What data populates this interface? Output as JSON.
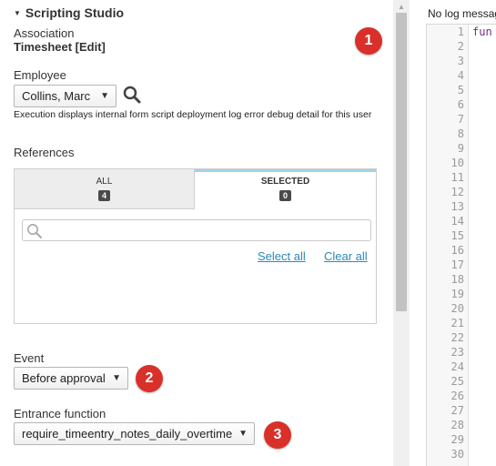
{
  "studio": {
    "title": "Scripting Studio",
    "association_label": "Association",
    "association_value": "Timesheet [Edit]",
    "employee_label": "Employee",
    "employee_value": "Collins, Marc",
    "execution_note": "Execution displays internal form script deployment log error debug detail for this user",
    "references_label": "References",
    "tabs": [
      {
        "label": "ALL",
        "count": "4"
      },
      {
        "label": "SELECTED",
        "count": "0"
      }
    ],
    "select_all": "Select all",
    "clear_all": "Clear all",
    "event_label": "Event",
    "event_value": "Before approval",
    "entrance_label": "Entrance function",
    "entrance_value": "require_timeentry_notes_daily_overtime"
  },
  "badges": [
    "1",
    "2",
    "3"
  ],
  "log": {
    "message": "No log messages"
  },
  "editor": {
    "code_line1": "fun",
    "line_numbers": [
      "1",
      "2",
      "3",
      "4",
      "5",
      "6",
      "7",
      "8",
      "9",
      "10",
      "11",
      "12",
      "13",
      "14",
      "15",
      "16",
      "17",
      "18",
      "19",
      "20",
      "21",
      "22",
      "23",
      "24",
      "25",
      "26",
      "27",
      "28",
      "29",
      "30"
    ]
  },
  "colors": {
    "badge": "#d9302a",
    "link": "#2a8ab8",
    "tab_accent": "#a3d0e8"
  }
}
